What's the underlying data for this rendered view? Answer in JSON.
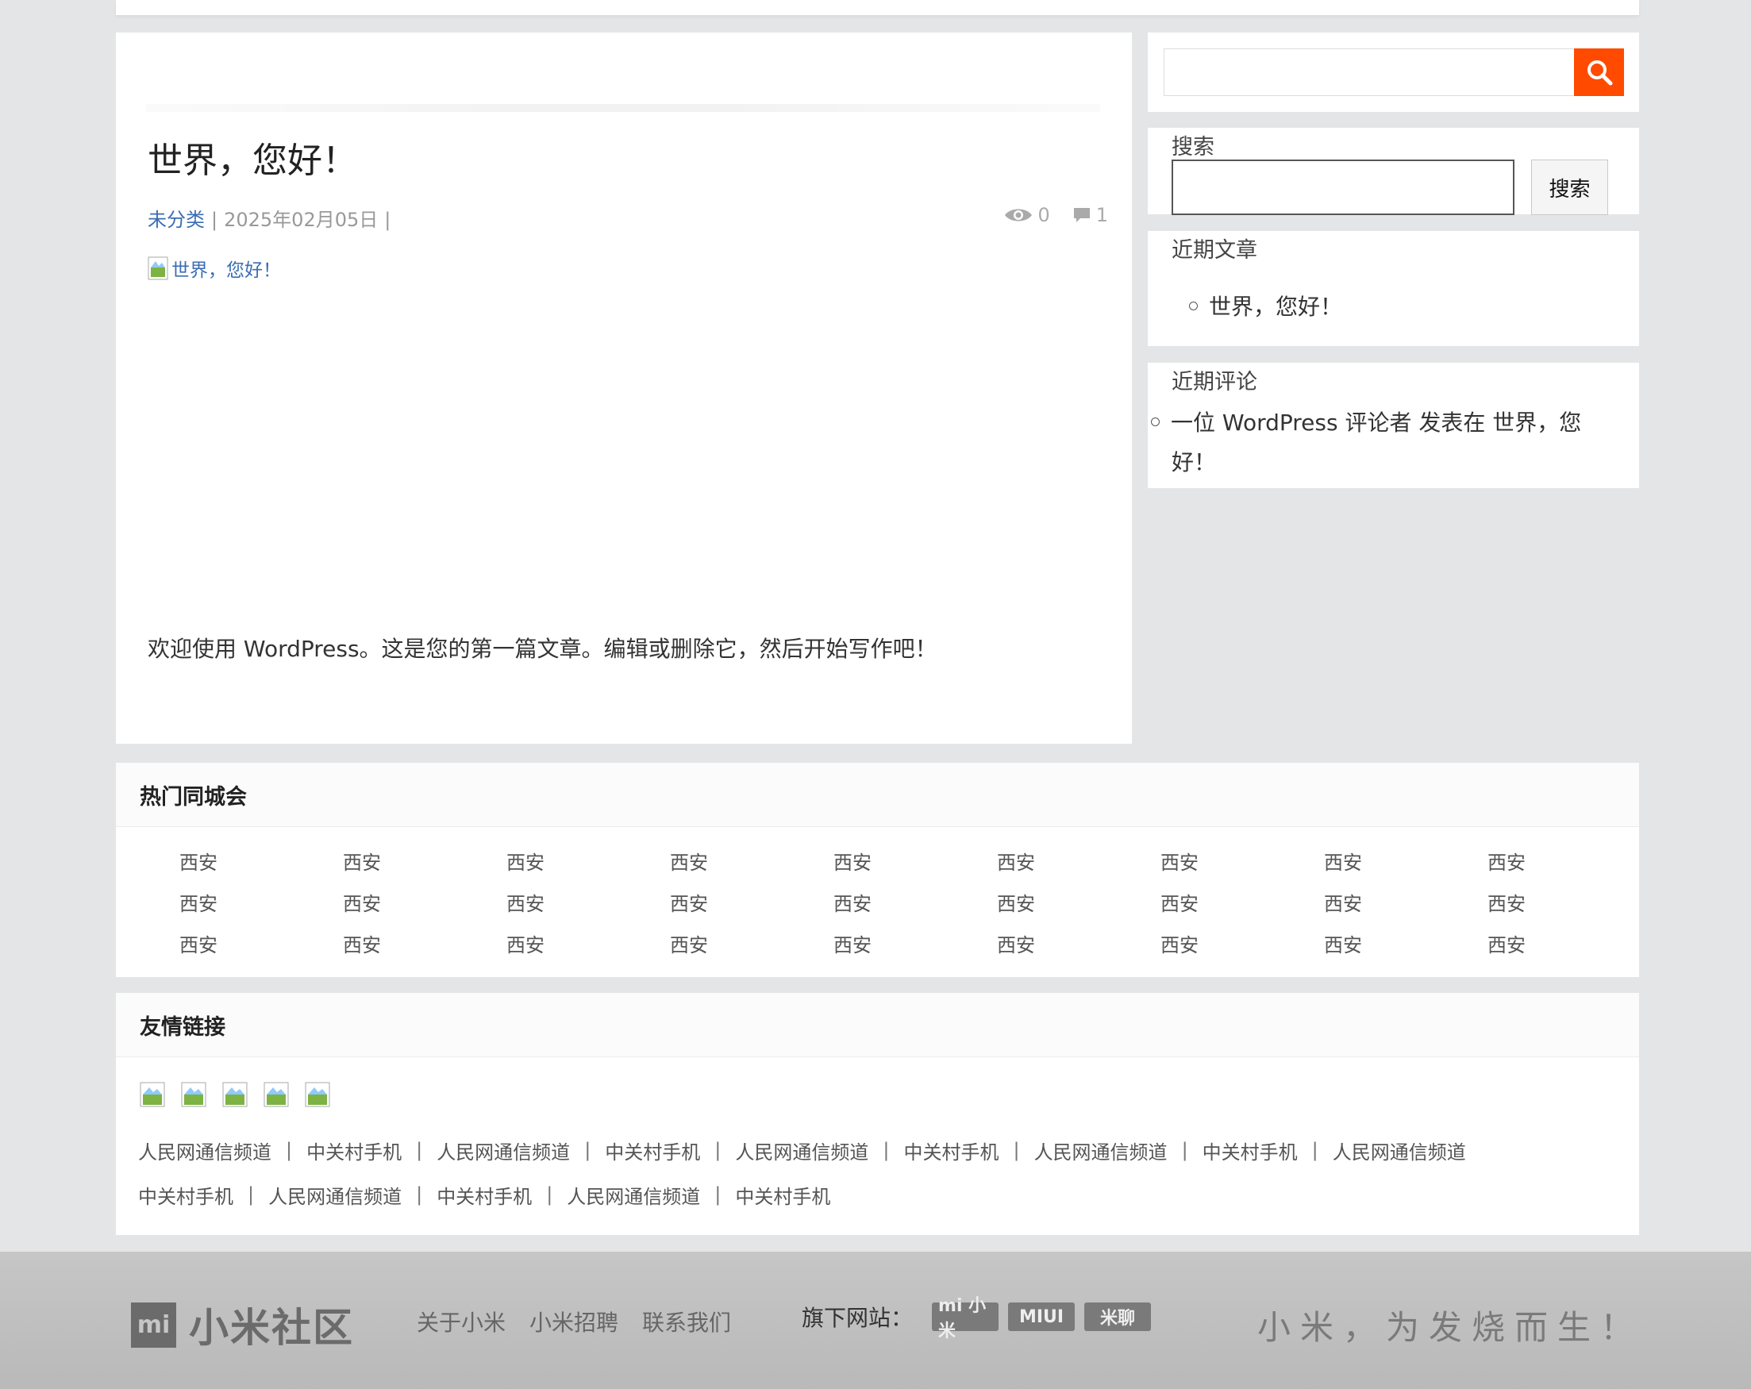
{
  "post": {
    "title": "世界，您好！",
    "category": "未分类",
    "date": "2025年02月05日",
    "meta_sep": "|",
    "views": "0",
    "comments": "1",
    "image_alt": "世界，您好！",
    "body": "欢迎使用 WordPress。这是您的第一篇文章。编辑或删除它，然后开始写作吧！"
  },
  "sidebar": {
    "search_title": "搜索",
    "search_button": "搜索",
    "recent_posts_title": "近期文章",
    "recent_posts": [
      "世界，您好！"
    ],
    "recent_comments_title": "近期评论",
    "recent_comment_line1": "一位 WordPress 评论者 发表在 世界，您",
    "recent_comment_line2": "好！"
  },
  "cities": {
    "title": "热门同城会",
    "items": [
      "西安",
      "西安",
      "西安",
      "西安",
      "西安",
      "西安",
      "西安",
      "西安",
      "西安",
      "西安",
      "西安",
      "西安",
      "西安",
      "西安",
      "西安",
      "西安",
      "西安",
      "西安",
      "西安",
      "西安",
      "西安",
      "西安",
      "西安",
      "西安",
      "西安",
      "西安",
      "西安"
    ]
  },
  "links": {
    "title": "友情链接",
    "row1": [
      "人民网通信频道",
      "中关村手机",
      "人民网通信频道",
      "中关村手机",
      "人民网通信频道",
      "中关村手机",
      "人民网通信频道",
      "中关村手机",
      "人民网通信频道"
    ],
    "row2": [
      "中关村手机",
      "人民网通信频道",
      "中关村手机",
      "人民网通信频道",
      "中关村手机"
    ],
    "sep": "|"
  },
  "footer": {
    "logo_mark": "mi",
    "logo_text": "小米社区",
    "nav": [
      "关于小米",
      "小米招聘",
      "联系我们"
    ],
    "sites_label": "旗下网站：",
    "site_badges": [
      "mi 小米",
      "MIUI",
      "米聊"
    ],
    "slogan": "小米，为发烧而生！"
  },
  "colors": {
    "accent": "#ff4a00",
    "link": "#3b6db3",
    "background": "#e4e5e6"
  }
}
